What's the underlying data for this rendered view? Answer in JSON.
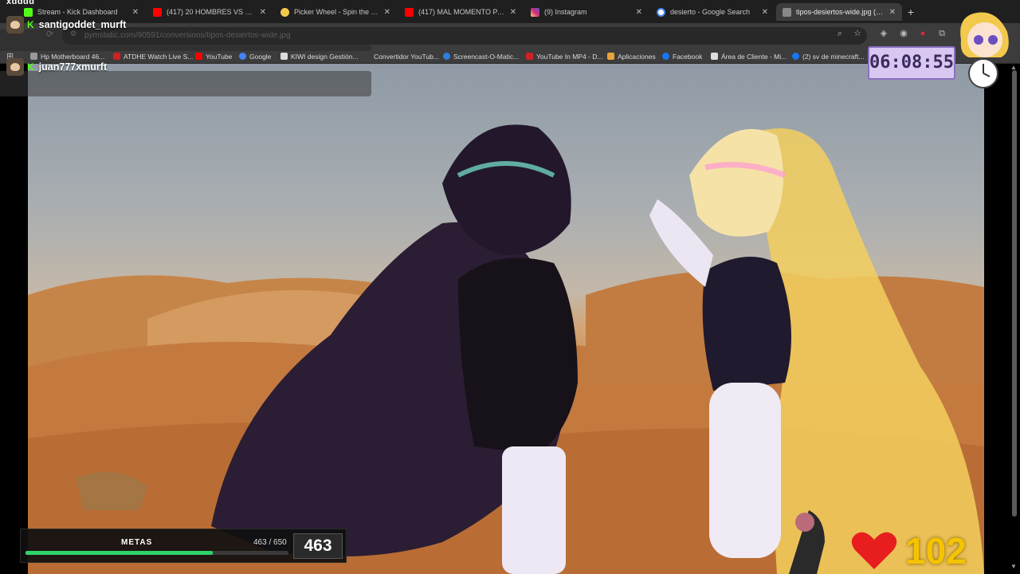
{
  "overlay_top_word": "xdddd",
  "tabs": [
    {
      "title": "Stream - Kick Dashboard",
      "color": "#53fc18"
    },
    {
      "title": "(417) 20 HOMBRES VS 1 ARTI...",
      "color": "#ff0000"
    },
    {
      "title": "Picker Wheel - Spin the Wheel",
      "color": "#f2c94c"
    },
    {
      "title": "(417) MAL MOMENTO PARA LL...",
      "color": "#ff0000"
    },
    {
      "title": "(9) Instagram",
      "color": "#d62976"
    },
    {
      "title": "desierto - Google Search",
      "color": "#4285f4"
    },
    {
      "title": "tipos-desiertos-wide.jpg (1200...",
      "color": "#888888"
    }
  ],
  "address_bar": {
    "url": "pymstatic.com/90591/conversions/tipos-desiertos-wide.jpg"
  },
  "bookmarks": [
    {
      "label": "Hp Motherboard 46...",
      "color": "#999999"
    },
    {
      "label": "ATDHE Watch Live S...",
      "color": "#cc2222"
    },
    {
      "label": "YouTube",
      "color": "#ff0000"
    },
    {
      "label": "Google",
      "color": "#4285f4"
    },
    {
      "label": "KIWI design Gestión...",
      "color": "#dddddd"
    },
    {
      "label": "Convertidor YouTub...",
      "color": "#3c3c3c"
    },
    {
      "label": "Screencast-O-Matic...",
      "color": "#2d7fd8"
    },
    {
      "label": "YouTube In MP4 - D...",
      "color": "#cc2222"
    },
    {
      "label": "Aplicaciones",
      "color": "#e8a33d"
    },
    {
      "label": "Facebook",
      "color": "#1877f2"
    },
    {
      "label": "Área de Cliente - Mi...",
      "color": "#dddddd"
    },
    {
      "label": "(2) sv de minecraft...",
      "color": "#1877f2"
    }
  ],
  "chat": [
    {
      "user": "santigoddet_murft",
      "platform": "K"
    },
    {
      "user": "juan777xmurft",
      "platform": "K"
    }
  ],
  "timer": {
    "value": "06:08:55"
  },
  "goal": {
    "title": "METAS",
    "current": 463,
    "target": 650,
    "count_text": "463 / 650",
    "big_value": "463",
    "progress": 0.712
  },
  "likes": {
    "count": "102"
  },
  "colors": {
    "kick_green": "#53fc18",
    "timer_bg": "#d8c7f0",
    "goal_fill": "#2fd36a",
    "likes_gold": "#f5c400",
    "heart_red": "#e81e1e"
  }
}
